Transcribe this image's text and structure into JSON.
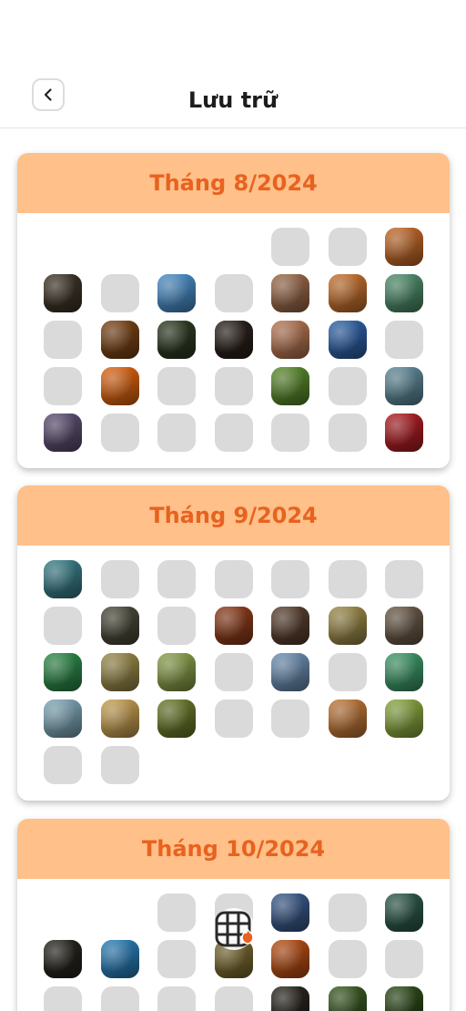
{
  "header": {
    "title": "Lưu trữ",
    "back_icon": "chevron-left-icon"
  },
  "months": [
    {
      "label": "Tháng 8/2024",
      "cells": [
        "e",
        "e",
        "e",
        "e",
        "g",
        "g",
        "#c46a2a",
        "#3e3528",
        "g",
        "#4a8ec8",
        "g",
        "#9c6a4a",
        "#c7712e",
        "#4f8e6c",
        "g",
        "#7a4416",
        "#2e3b23",
        "#2b211c",
        "#b77653",
        "#2e62a8",
        "g",
        "g",
        "#e06512",
        "g",
        "g",
        "#5b8a2d",
        "g",
        "#5f8a9a",
        "#5e4f72",
        "g",
        "g",
        "g",
        "g",
        "g",
        "#b01e24"
      ]
    },
    {
      "label": "Tháng 9/2024",
      "cells": [
        "#3a7e8a",
        "g",
        "g",
        "g",
        "g",
        "g",
        "g",
        "g",
        "#4a4a3a",
        "g",
        "#8d3c1a",
        "#5a4030",
        "#9c8a4a",
        "#6a5a48",
        "#2e8a4a",
        "#9a8a4a",
        "#8aa04a",
        "g",
        "#6c8fb2",
        "g",
        "#3e9a6a",
        "#7fa8b8",
        "#c8a052",
        "#6a7a2a",
        "g",
        "g",
        "#c07838",
        "#8aa840",
        "g",
        "g",
        "e",
        "e",
        "e",
        "e",
        "e"
      ]
    },
    {
      "label": "Tháng 10/2024",
      "cells": [
        "e",
        "e",
        "g",
        "g",
        "#3a5a8a",
        "g",
        "#2e5a4a",
        "#26251e",
        "#2a7fb8",
        "g",
        "#7a6a30",
        "#b84e14",
        "g",
        "g",
        "g",
        "g",
        "g",
        "g",
        "#2a2620",
        "#3a5a22",
        "#2e4a1a"
      ]
    }
  ],
  "fab": {
    "icon": "film-frame-icon",
    "badge_icon": "flame-icon",
    "accent": "#e8621f"
  }
}
